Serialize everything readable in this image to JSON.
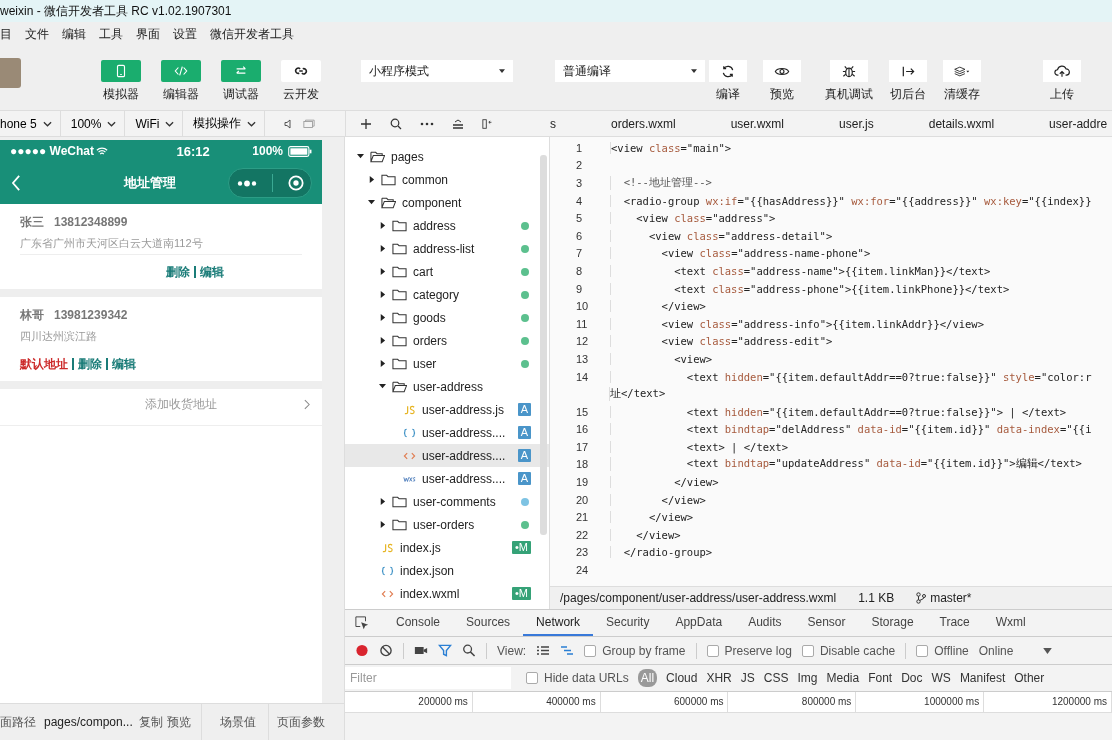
{
  "window": {
    "title": "weixin - 微信开发者工具 RC v1.02.1907301"
  },
  "menu": [
    "目",
    "文件",
    "编辑",
    "工具",
    "界面",
    "设置",
    "微信开发者工具"
  ],
  "toolbar": {
    "modes": [
      {
        "label": "模拟器",
        "selected": true
      },
      {
        "label": "编辑器",
        "selected": true
      },
      {
        "label": "调试器",
        "selected": true
      },
      {
        "label": "云开发",
        "selected": false
      }
    ],
    "mode_select": "小程序模式",
    "compile_select": "普通编译",
    "actions": [
      {
        "label": "编译"
      },
      {
        "label": "预览"
      },
      {
        "label": "真机调试"
      },
      {
        "label": "切后台"
      },
      {
        "label": "清缓存"
      },
      {
        "label": "上传"
      }
    ]
  },
  "simulator_bar": {
    "selects": [
      "hone 5",
      "100%",
      "WiFi",
      "模拟操作"
    ]
  },
  "editor_tabs": [
    {
      "label": "s",
      "selected": false
    },
    {
      "label": "orders.wxml",
      "selected": false
    },
    {
      "label": "user.wxml",
      "selected": false
    },
    {
      "label": "user.js",
      "selected": false
    },
    {
      "label": "details.wxml",
      "selected": false
    },
    {
      "label": "user-addre",
      "selected": false
    }
  ],
  "phone": {
    "carrier": "●●●●● WeChat",
    "time": "16:12",
    "battery": "100%",
    "title": "地址管理",
    "addresses": [
      {
        "name": "张三",
        "phone": "13812348899",
        "address": "广东省广州市天河区白云大道南112号",
        "is_default": false,
        "delete": "删除",
        "edit": "编辑"
      },
      {
        "name": "林哥",
        "phone": "13981239342",
        "address": "四川达州滨江路",
        "is_default": true,
        "default_label": "默认地址",
        "delete": "删除",
        "edit": "编辑"
      }
    ],
    "add_label": "添加收货地址"
  },
  "status_bar": {
    "path_label": "面路径",
    "path": "pages/compon...",
    "copy": "复制",
    "preview": "预览",
    "scene": "场景值",
    "params": "页面参数"
  },
  "file_tree": [
    {
      "name": "pages",
      "kind": "folder",
      "expanded": true,
      "children": [
        {
          "name": "common",
          "kind": "folder",
          "expanded": false
        },
        {
          "name": "component",
          "kind": "folder",
          "expanded": true,
          "children": [
            {
              "name": "address",
              "kind": "folder",
              "expanded": false,
              "color": "#5cc08e"
            },
            {
              "name": "address-list",
              "kind": "folder",
              "expanded": false,
              "color": "#5cc08e"
            },
            {
              "name": "cart",
              "kind": "folder",
              "expanded": false,
              "color": "#5cc08e"
            },
            {
              "name": "category",
              "kind": "folder",
              "expanded": false,
              "color": "#5cc08e"
            },
            {
              "name": "goods",
              "kind": "folder",
              "expanded": false,
              "color": "#5cc08e"
            },
            {
              "name": "orders",
              "kind": "folder",
              "expanded": false,
              "color": "#5cc08e"
            },
            {
              "name": "user",
              "kind": "folder",
              "expanded": false,
              "color": "#5cc08e"
            },
            {
              "name": "user-address",
              "kind": "folder",
              "expanded": true,
              "children": [
                {
                  "name": "user-address.js",
                  "kind": "js",
                  "badge": "A",
                  "selected": false
                },
                {
                  "name": "user-address....",
                  "kind": "json",
                  "badge": "A",
                  "selected": false
                },
                {
                  "name": "user-address....",
                  "kind": "wxml",
                  "badge": "A",
                  "selected": true
                },
                {
                  "name": "user-address....",
                  "kind": "wxss",
                  "badge": "A",
                  "selected": false
                }
              ]
            },
            {
              "name": "user-comments",
              "kind": "folder",
              "expanded": false,
              "color": "#7ec3e3"
            },
            {
              "name": "user-orders",
              "kind": "folder",
              "expanded": false,
              "color": "#5cc08e"
            }
          ]
        },
        {
          "name": "index.js",
          "kind": "js",
          "badge": "•M",
          "selected": false
        },
        {
          "name": "index.json",
          "kind": "json",
          "selected": false
        },
        {
          "name": "index.wxml",
          "kind": "wxml",
          "badge": "•M",
          "selected": false
        }
      ]
    }
  ],
  "code_lines": [
    {
      "number": "1",
      "text": "<view class=\"main\">"
    },
    {
      "number": "2"
    },
    {
      "number": "3",
      "text": "  <!--地址管理-->"
    },
    {
      "number": "4",
      "text": "  <radio-group wx:if=\"{{hasAddress}}\" wx:for=\"{{address}}\" wx:key=\"{{index}}"
    },
    {
      "number": "5",
      "text": "    <view class=\"address\">"
    },
    {
      "number": "6",
      "text": "      <view class=\"address-detail\">"
    },
    {
      "number": "7",
      "text": "        <view class=\"address-name-phone\">"
    },
    {
      "number": "8",
      "text": "          <text class=\"address-name\">{{item.linkMan}}</text>"
    },
    {
      "number": "9",
      "text": "          <text class=\"address-phone\">{{item.linkPhone}}</text>"
    },
    {
      "number": "10",
      "text": "        </view>"
    },
    {
      "number": "11",
      "text": "        <view class=\"address-info\">{{item.linkAddr}}</view>"
    },
    {
      "number": "12",
      "text": "        <view class=\"address-edit\">"
    },
    {
      "number": "13",
      "text": "          <view>"
    },
    {
      "number": "14",
      "text": "            <text hidden=\"{{item.defaultAddr==0?true:false}}\" style=\"color:r",
      "wrap": "址</text>"
    },
    {
      "number": "15",
      "text": "            <text hidden=\"{{item.defaultAddr==0?true:false}}\"> | </text>"
    },
    {
      "number": "16",
      "text": "            <text bindtap=\"delAddress\" data-id=\"{{item.id}}\" data-index=\"{{i"
    },
    {
      "number": "17",
      "text": "            <text> | </text>"
    },
    {
      "number": "18",
      "text": "            <text bindtap=\"updateAddress\" data-id=\"{{item.id}}\">编辑</text>"
    },
    {
      "number": "19",
      "text": "          </view>"
    },
    {
      "number": "20",
      "text": "        </view>"
    },
    {
      "number": "21",
      "text": "      </view>"
    },
    {
      "number": "22",
      "text": "    </view>"
    },
    {
      "number": "23",
      "text": "  </radio-group>"
    },
    {
      "number": "24"
    }
  ],
  "file_info": {
    "path": "/pages/component/user-address/user-address.wxml",
    "size": "1.1 KB",
    "branch": "master*"
  },
  "devtools": {
    "tabs": [
      {
        "label": "Console",
        "selected": false
      },
      {
        "label": "Sources",
        "selected": false
      },
      {
        "label": "Network",
        "selected": true
      },
      {
        "label": "Security",
        "selected": false
      },
      {
        "label": "AppData",
        "selected": false
      },
      {
        "label": "Audits",
        "selected": false
      },
      {
        "label": "Sensor",
        "selected": false
      },
      {
        "label": "Storage",
        "selected": false
      },
      {
        "label": "Trace",
        "selected": false
      },
      {
        "label": "Wxml",
        "selected": false
      }
    ],
    "view_label": "View:",
    "options": [
      {
        "label": "Group by frame",
        "checked": false
      },
      {
        "label": "Preserve log",
        "checked": false
      },
      {
        "label": "Disable cache",
        "checked": false
      },
      {
        "label": "Offline",
        "checked": false
      }
    ],
    "throttle": "Online",
    "filter_placeholder": "Filter",
    "hide_urls": {
      "label": "Hide data URLs",
      "checked": false
    },
    "types": [
      {
        "label": "All",
        "selected": true
      },
      {
        "label": "Cloud",
        "selected": false
      },
      {
        "label": "XHR",
        "selected": false
      },
      {
        "label": "JS",
        "selected": false
      },
      {
        "label": "CSS",
        "selected": false
      },
      {
        "label": "Img",
        "selected": false
      },
      {
        "label": "Media",
        "selected": false
      },
      {
        "label": "Font",
        "selected": false
      },
      {
        "label": "Doc",
        "selected": false
      },
      {
        "label": "WS",
        "selected": false
      },
      {
        "label": "Manifest",
        "selected": false
      },
      {
        "label": "Other",
        "selected": false
      }
    ],
    "ticks": [
      "200000 ms",
      "400000 ms",
      "600000 ms",
      "800000 ms",
      "1000000 ms",
      "1200000 ms"
    ]
  }
}
